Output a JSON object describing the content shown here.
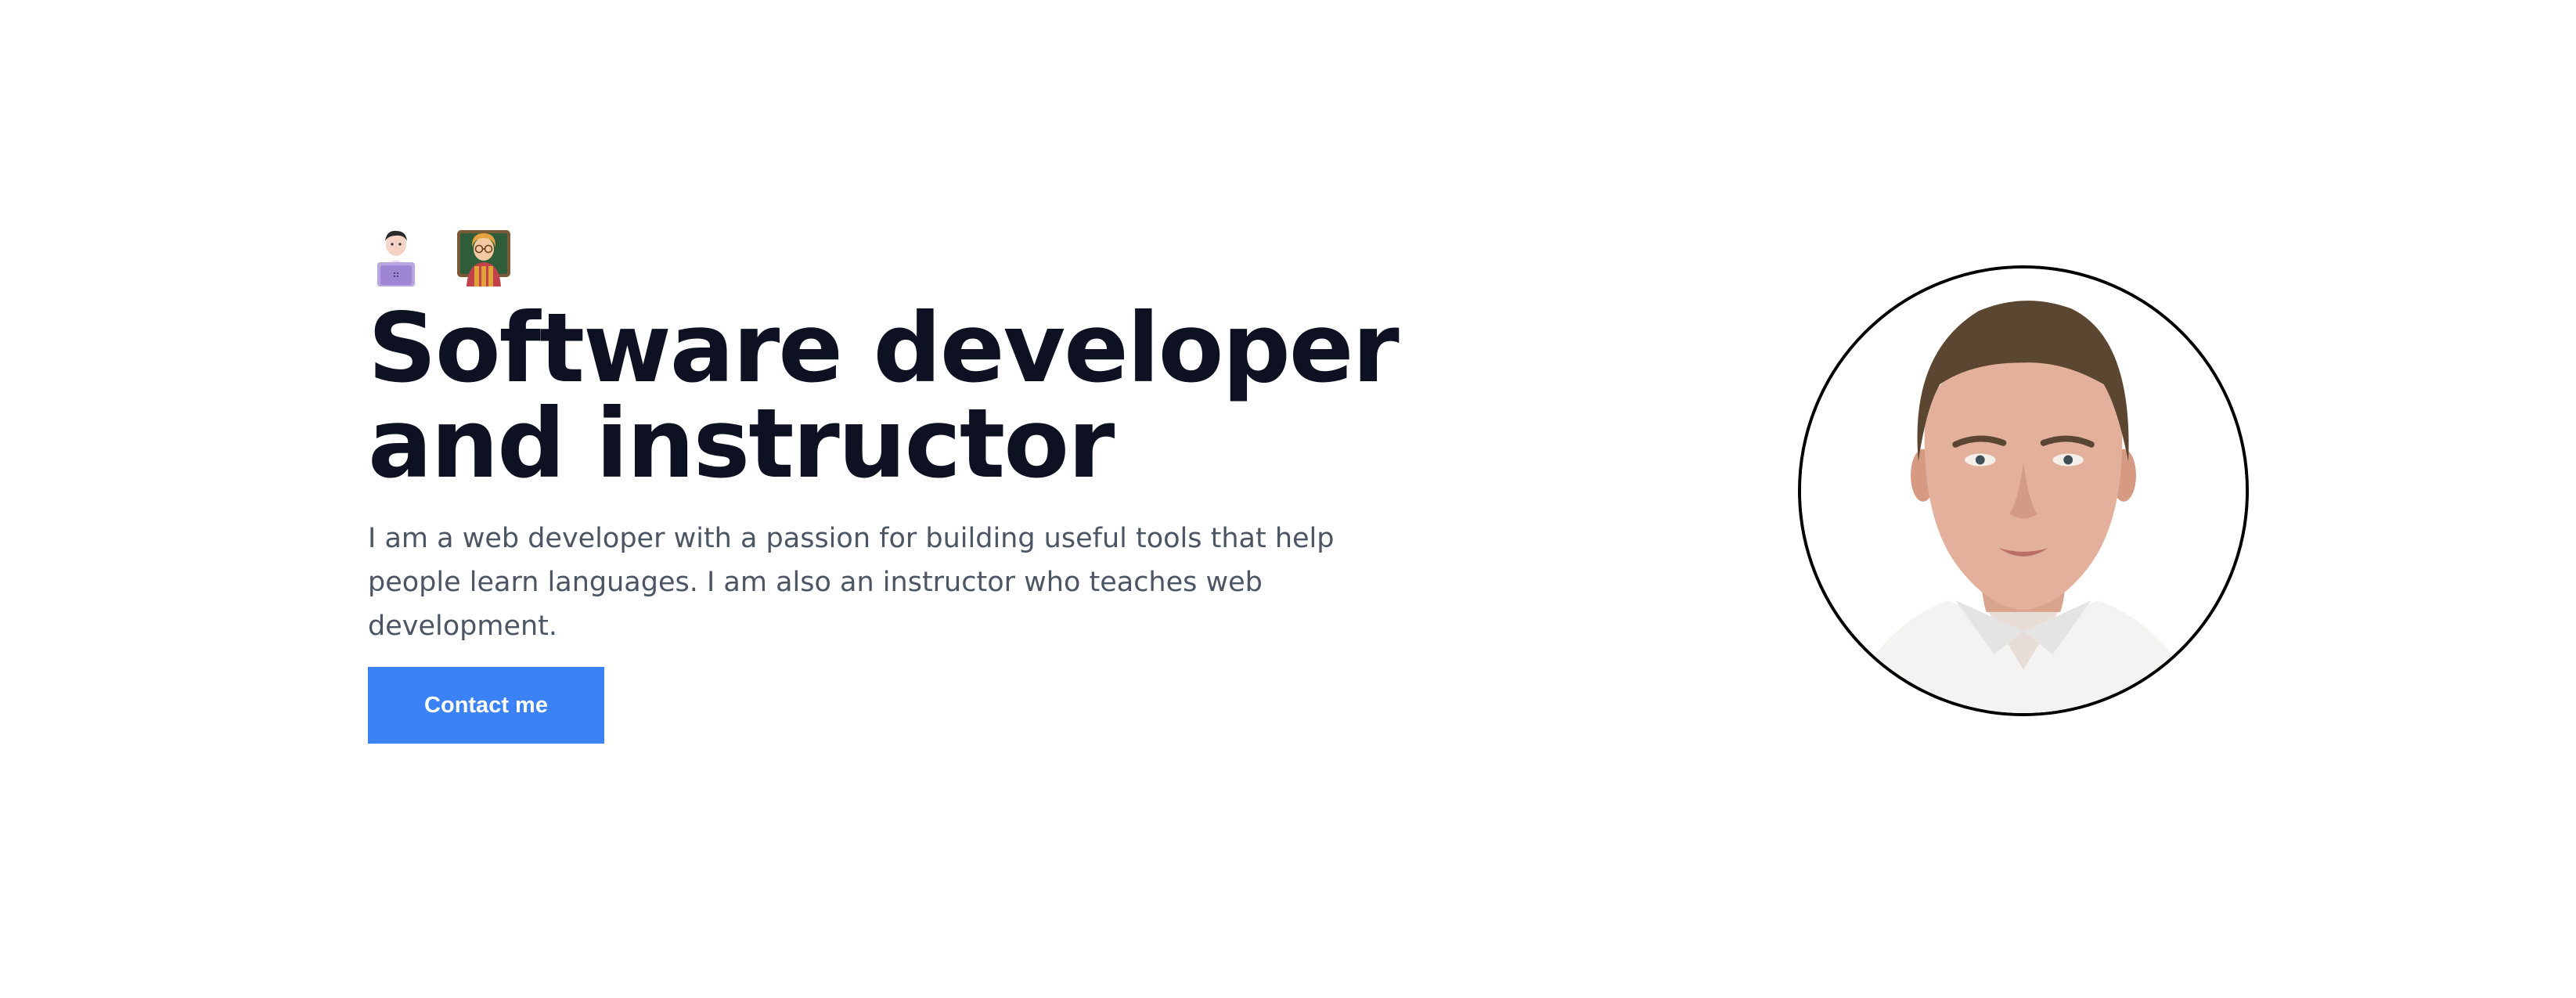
{
  "hero": {
    "emojis": [
      {
        "icon": "technologist-laptop-icon"
      },
      {
        "icon": "teacher-chalkboard-icon"
      }
    ],
    "headline_line1": "Software developer",
    "headline_line2": "and instructor",
    "description": "I am a web developer with a passion for building useful tools that help people learn languages. I am also an instructor who teaches web development.",
    "cta_label": "Contact me",
    "portrait": {
      "icon": "profile-photo"
    }
  },
  "colors": {
    "heading": "#0d1122",
    "body_text": "#4b5563",
    "accent": "#3b82f6",
    "background": "#ffffff",
    "portrait_border": "#000000"
  }
}
